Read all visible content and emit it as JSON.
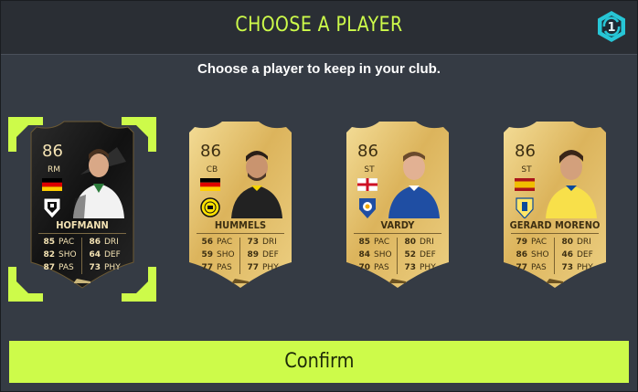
{
  "header": {
    "title": "CHOOSE A PLAYER",
    "badge_number": "1"
  },
  "subtitle": "Choose a player to keep in your club.",
  "colors": {
    "accent": "#cdfb4a",
    "gold_card": "#e6c26a",
    "black_card": "#1c1c1c"
  },
  "players": [
    {
      "name": "HOFMANN",
      "rating": "86",
      "position": "RM",
      "nation_flag": "germany-flag",
      "club_icon": "gladbach-crest-icon",
      "card_style": "black",
      "selected": true,
      "stats": [
        {
          "value": "85",
          "label": "PAC"
        },
        {
          "value": "82",
          "label": "SHO"
        },
        {
          "value": "87",
          "label": "PAS"
        },
        {
          "value": "86",
          "label": "DRI"
        },
        {
          "value": "64",
          "label": "DEF"
        },
        {
          "value": "73",
          "label": "PHY"
        }
      ]
    },
    {
      "name": "HUMMELS",
      "rating": "86",
      "position": "CB",
      "nation_flag": "germany-flag",
      "club_icon": "bvb-crest-icon",
      "card_style": "gold",
      "selected": false,
      "stats": [
        {
          "value": "56",
          "label": "PAC"
        },
        {
          "value": "59",
          "label": "SHO"
        },
        {
          "value": "77",
          "label": "PAS"
        },
        {
          "value": "73",
          "label": "DRI"
        },
        {
          "value": "89",
          "label": "DEF"
        },
        {
          "value": "77",
          "label": "PHY"
        }
      ]
    },
    {
      "name": "VARDY",
      "rating": "86",
      "position": "ST",
      "nation_flag": "england-flag",
      "club_icon": "leicester-crest-icon",
      "card_style": "gold",
      "selected": false,
      "stats": [
        {
          "value": "85",
          "label": "PAC"
        },
        {
          "value": "84",
          "label": "SHO"
        },
        {
          "value": "70",
          "label": "PAS"
        },
        {
          "value": "80",
          "label": "DRI"
        },
        {
          "value": "52",
          "label": "DEF"
        },
        {
          "value": "73",
          "label": "PHY"
        }
      ]
    },
    {
      "name": "GERARD MORENO",
      "rating": "86",
      "position": "ST",
      "nation_flag": "spain-flag",
      "club_icon": "villarreal-crest-icon",
      "card_style": "gold",
      "selected": false,
      "stats": [
        {
          "value": "79",
          "label": "PAC"
        },
        {
          "value": "86",
          "label": "SHO"
        },
        {
          "value": "77",
          "label": "PAS"
        },
        {
          "value": "80",
          "label": "DRI"
        },
        {
          "value": "46",
          "label": "DEF"
        },
        {
          "value": "73",
          "label": "PHY"
        }
      ]
    }
  ],
  "confirm_label": "Confirm"
}
